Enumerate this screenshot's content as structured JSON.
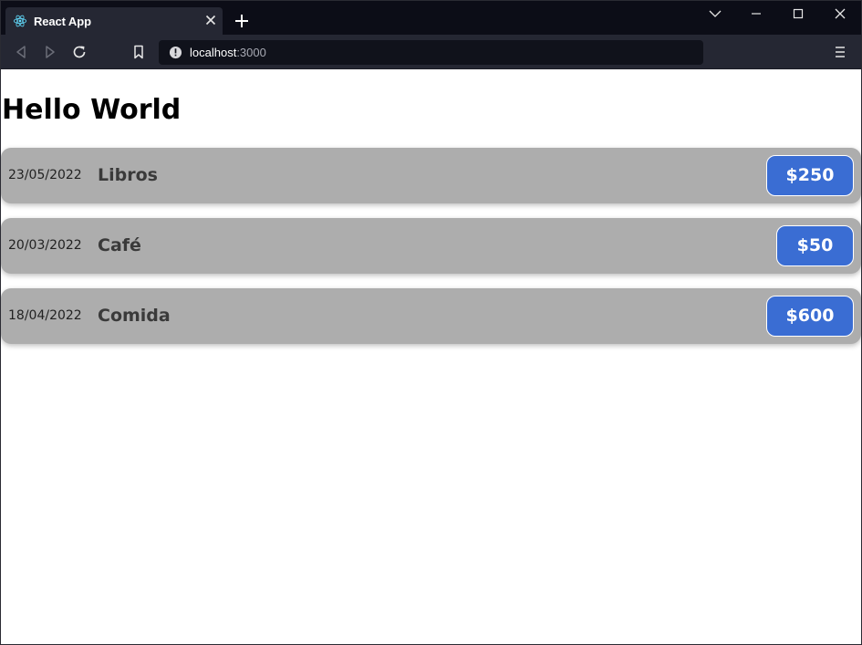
{
  "browser": {
    "tab_title": "React App",
    "url_host": "localhost",
    "url_port": ":3000"
  },
  "page": {
    "title": "Hello World",
    "expenses": [
      {
        "date": "23/05/2022",
        "description": "Libros",
        "price": "$250"
      },
      {
        "date": "20/03/2022",
        "description": "Café",
        "price": "$50"
      },
      {
        "date": "18/04/2022",
        "description": "Comida",
        "price": "$600"
      }
    ]
  },
  "colors": {
    "card_bg": "#adadad",
    "price_badge": "#3a6dd3",
    "chrome_dark": "#0c0d17",
    "toolbar": "#252733"
  },
  "icons": [
    "react-logo-icon",
    "close-icon",
    "plus-icon",
    "chevron-down-icon",
    "minimize-icon",
    "maximize-icon",
    "window-close-icon",
    "back-arrow-icon",
    "forward-arrow-icon",
    "reload-icon",
    "bookmark-icon",
    "info-icon",
    "menu-icon"
  ]
}
